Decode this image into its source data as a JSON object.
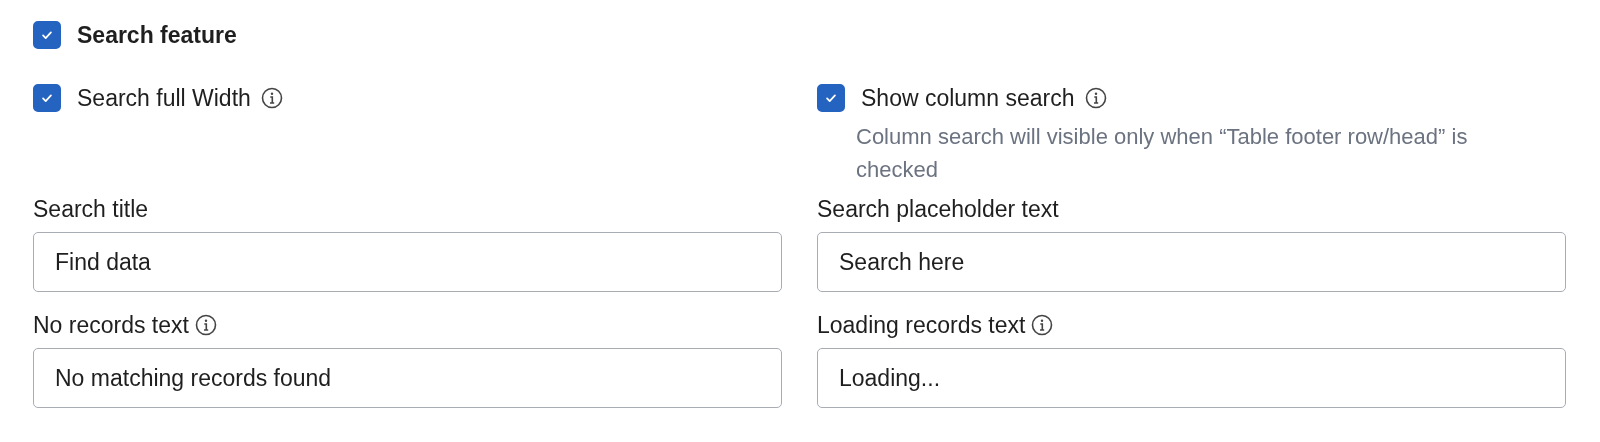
{
  "section": {
    "label": "Search feature",
    "checked": true
  },
  "options": [
    {
      "label": "Search full Width",
      "checked": true,
      "info": true
    },
    {
      "label": "Show column search",
      "checked": true,
      "info": true,
      "help": "Column search will visible only when “Table footer row/head” is checked"
    }
  ],
  "fields": [
    {
      "label": "Search title",
      "info": false,
      "value": "Find data"
    },
    {
      "label": "Search placeholder text",
      "info": false,
      "value": "Search here"
    },
    {
      "label": "No records text",
      "info": true,
      "value": "No matching records found"
    },
    {
      "label": "Loading records text",
      "info": true,
      "value": "Loading..."
    }
  ]
}
